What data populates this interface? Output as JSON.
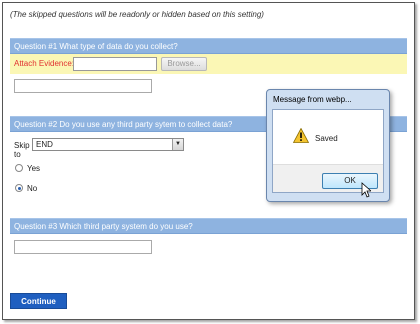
{
  "page": {
    "note": "(The skipped questions will be readonly or hidden based on this setting)"
  },
  "question1": {
    "header": "Question #1 What type of data do you collect?",
    "evidence_label": "Attach Evidence:",
    "evidence_value": "",
    "browse_label": "Browse...",
    "answer_value": ""
  },
  "question2": {
    "header": "Question #2 Do you use any third party sytem to collect data?",
    "skip_label": "Skip to",
    "skip_selected": "END",
    "options": [
      {
        "label": "Yes",
        "checked": false
      },
      {
        "label": "No",
        "checked": true
      }
    ]
  },
  "question3": {
    "header": "Question #3 Which third party system do you use?",
    "answer_value": ""
  },
  "footer": {
    "continue_label": "Continue"
  },
  "dialog": {
    "title": "Message from webp...",
    "message": "Saved",
    "ok_label": "OK",
    "icon": "warning-icon"
  },
  "colors": {
    "header_blue": "#8eb3e0",
    "evidence_yellow": "#fbf7b5",
    "evidence_label_red": "#e03030",
    "continue_blue": "#1f5fc0"
  }
}
